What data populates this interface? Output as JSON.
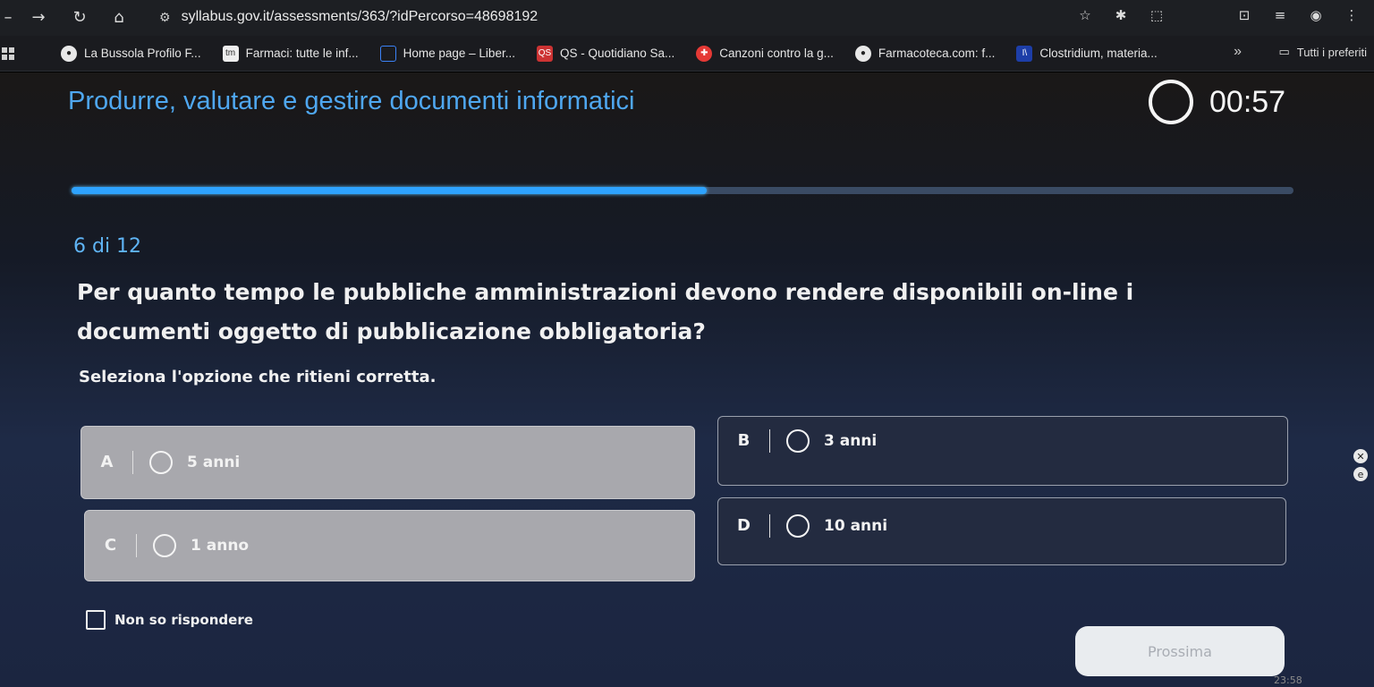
{
  "browser": {
    "url": "syllabus.gov.it/assessments/363/?idPercorso=48698192",
    "bookmarks": [
      {
        "label": "La Bussola Profilo F...",
        "icon": "globe-icon"
      },
      {
        "label": "Farmaci: tutte le inf...",
        "icon": "tm-favicon"
      },
      {
        "label": "Home page – Liber...",
        "icon": "page-favicon"
      },
      {
        "label": "QS - Quotidiano Sa...",
        "icon": "qs-favicon"
      },
      {
        "label": "Canzoni contro la g...",
        "icon": "emergency-favicon"
      },
      {
        "label": "Farmacoteca.com: f...",
        "icon": "globe-icon"
      },
      {
        "label": "Clostridium, materia...",
        "icon": "book-favicon"
      }
    ],
    "all_bookmarks_label": "Tutti i preferiti"
  },
  "quiz": {
    "title": "Produrre, valutare e gestire documenti informatici",
    "timer": "00:57",
    "progress": 0.5,
    "counter": "6 di 12",
    "question": "Per quanto tempo le pubbliche amministrazioni devono rendere disponibili on-line i documenti oggetto di pubblicazione obbligatoria?",
    "instruction": "Seleziona l'opzione che ritieni corretta.",
    "options": [
      {
        "letter": "A",
        "text": "5 anni"
      },
      {
        "letter": "B",
        "text": "3 anni"
      },
      {
        "letter": "C",
        "text": "1 anno"
      },
      {
        "letter": "D",
        "text": "10 anni"
      }
    ],
    "dont_know": "Non so rispondere",
    "next_label": "Prossima"
  },
  "system": {
    "clock": "23:58"
  },
  "colors": {
    "accent": "#4fa7f0",
    "progress": "#2ea3ff"
  }
}
